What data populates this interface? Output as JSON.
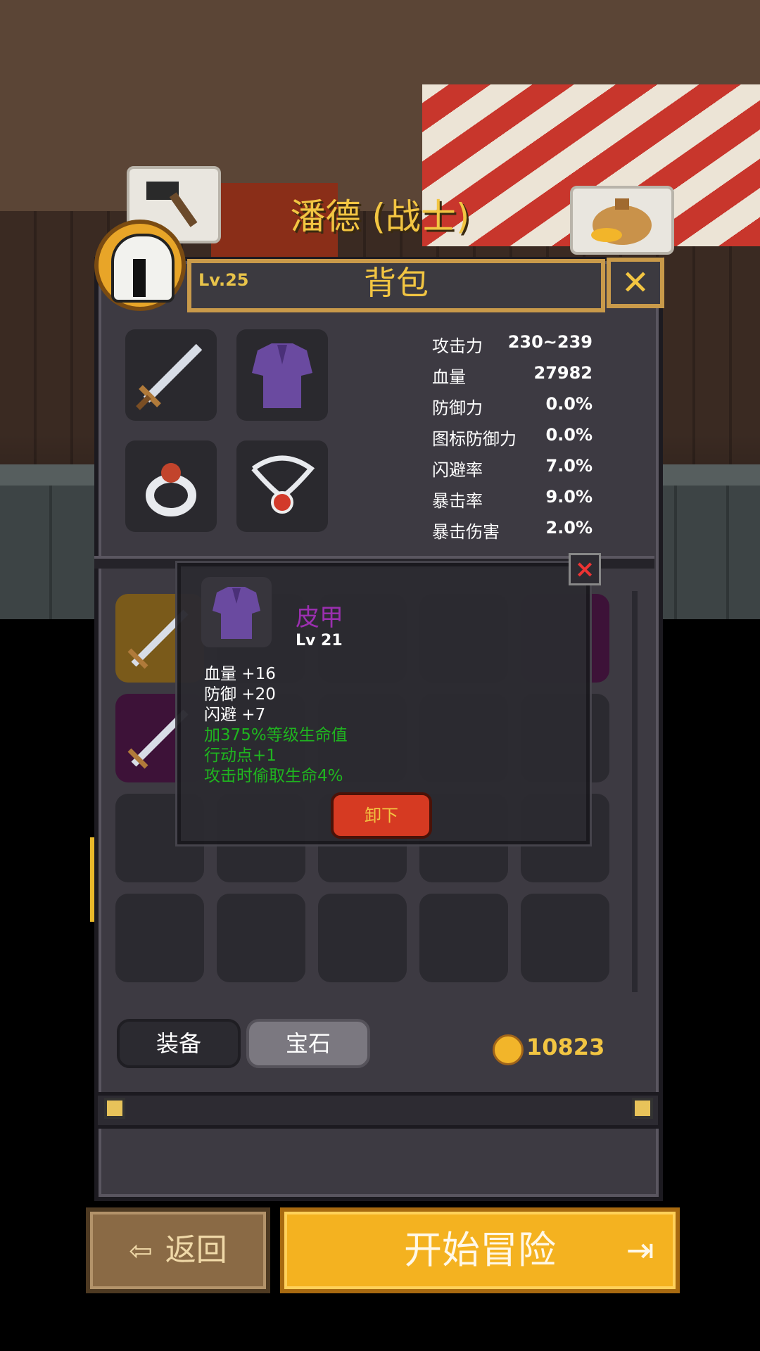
{
  "hero": {
    "name": "潘德 (战士)",
    "level": "Lv.25"
  },
  "panel": {
    "title": "背包",
    "close_label": "✕"
  },
  "stats": [
    {
      "label": "攻击力",
      "value": "230~239"
    },
    {
      "label": "血量",
      "value": "27982"
    },
    {
      "label": "防御力",
      "value": "0.0%"
    },
    {
      "label": "图标防御力",
      "value": "0.0%"
    },
    {
      "label": "闪避率",
      "value": "7.0%"
    },
    {
      "label": "暴击率",
      "value": "9.0%"
    },
    {
      "label": "暴击伤害",
      "value": "2.0%"
    }
  ],
  "tooltip": {
    "item_name": "皮甲",
    "item_level": "Lv 21",
    "lines": [
      {
        "text": "血量 +16",
        "color": "white"
      },
      {
        "text": "防御 +20",
        "color": "white"
      },
      {
        "text": "闪避 +7",
        "color": "white"
      },
      {
        "text": "加375%等级生命值",
        "color": "green"
      },
      {
        "text": "行动点+1",
        "color": "green"
      },
      {
        "text": "攻击时偷取生命4%",
        "color": "green"
      }
    ],
    "unequip_label": "卸下"
  },
  "tabs": {
    "equipment": "装备",
    "gems": "宝石"
  },
  "gold": "10823",
  "buttons": {
    "back": "返回",
    "start": "开始冒险"
  },
  "colors": {
    "accent": "#f2c542",
    "name_purple": "#9b2fb0",
    "bonus_green": "#1fb51f",
    "button_red": "#d63a22"
  }
}
